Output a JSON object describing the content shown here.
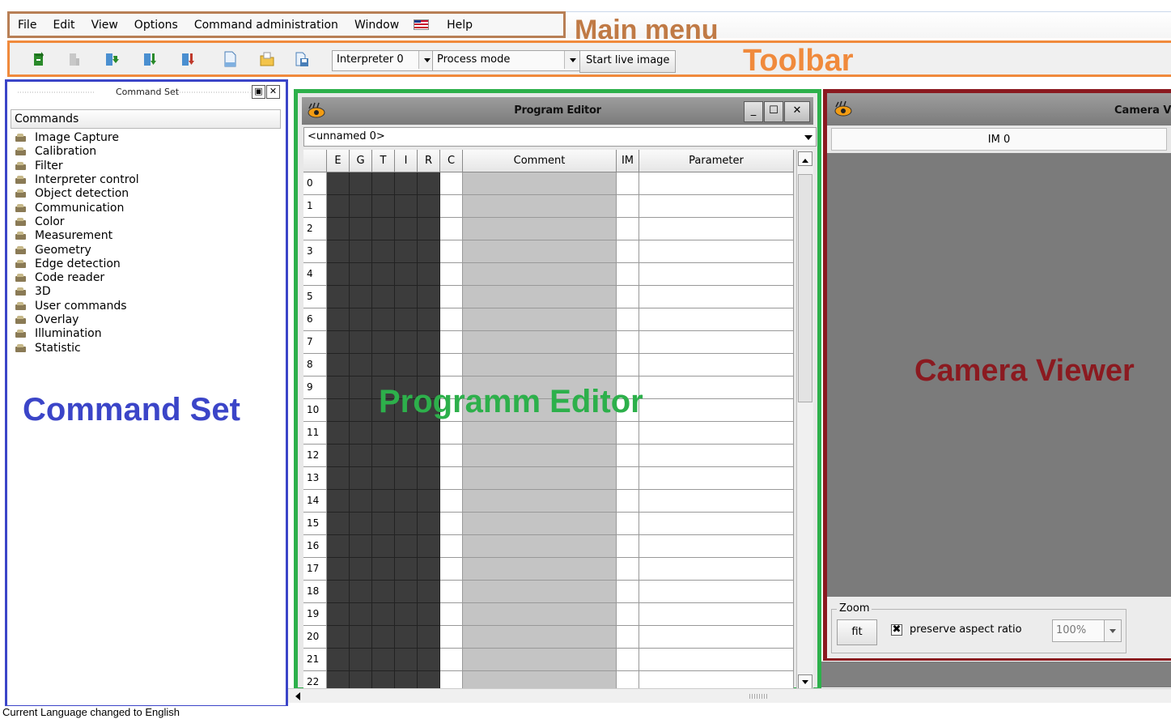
{
  "menu": {
    "items": [
      "File",
      "Edit",
      "View",
      "Options",
      "Command administration",
      "Window",
      "Help"
    ],
    "flag_icon": "us-flag-icon",
    "callout": "Main menu"
  },
  "toolbar": {
    "interpreter": "Interpreter 0",
    "mode": "Process mode",
    "live_button": "Start live image",
    "callout": "Toolbar",
    "icons": [
      "refresh-icon",
      "step-disabled-icon",
      "step-into-icon",
      "step-down-icon",
      "step-end-icon",
      "new-file-icon",
      "open-folder-icon",
      "save-icon"
    ]
  },
  "command_set": {
    "title": "Command Set",
    "header": "Commands",
    "items": [
      "Image Capture",
      "Calibration",
      "Filter",
      "Interpreter control",
      "Object detection",
      "Communication",
      "Color",
      "Measurement",
      "Geometry",
      "Edge detection",
      "Code reader",
      "3D",
      "User commands",
      "Overlay",
      "Illumination",
      "Statistic"
    ],
    "callout": "Command Set"
  },
  "program_editor": {
    "title": "Program Editor",
    "program_name": "<unnamed 0>",
    "columns": [
      "E",
      "G",
      "T",
      "I",
      "R",
      "C",
      "Comment",
      "IM",
      "Parameter"
    ],
    "rows": [
      "0",
      "1",
      "2",
      "3",
      "4",
      "5",
      "6",
      "7",
      "8",
      "9",
      "10",
      "11",
      "12",
      "13",
      "14",
      "15",
      "16",
      "17",
      "18",
      "19",
      "20",
      "21",
      "22"
    ],
    "callout": "Programm Editor"
  },
  "camera_viewer": {
    "title": "Camera Vie",
    "tab": "IM 0",
    "zoom_label": "Zoom",
    "fit_button": "fit",
    "preserve_label": "preserve aspect ratio",
    "preserve_checked": "✖",
    "zoom_value": "100%",
    "callout": "Camera Viewer"
  },
  "status": {
    "text": "Current Language changed to English"
  },
  "colors": {
    "menu_outline": "#b87f55",
    "toolbar_outline": "#f08a3c",
    "command_set_outline": "#3b45c8",
    "editor_outline": "#2db04b",
    "camera_outline": "#8b1a20"
  }
}
